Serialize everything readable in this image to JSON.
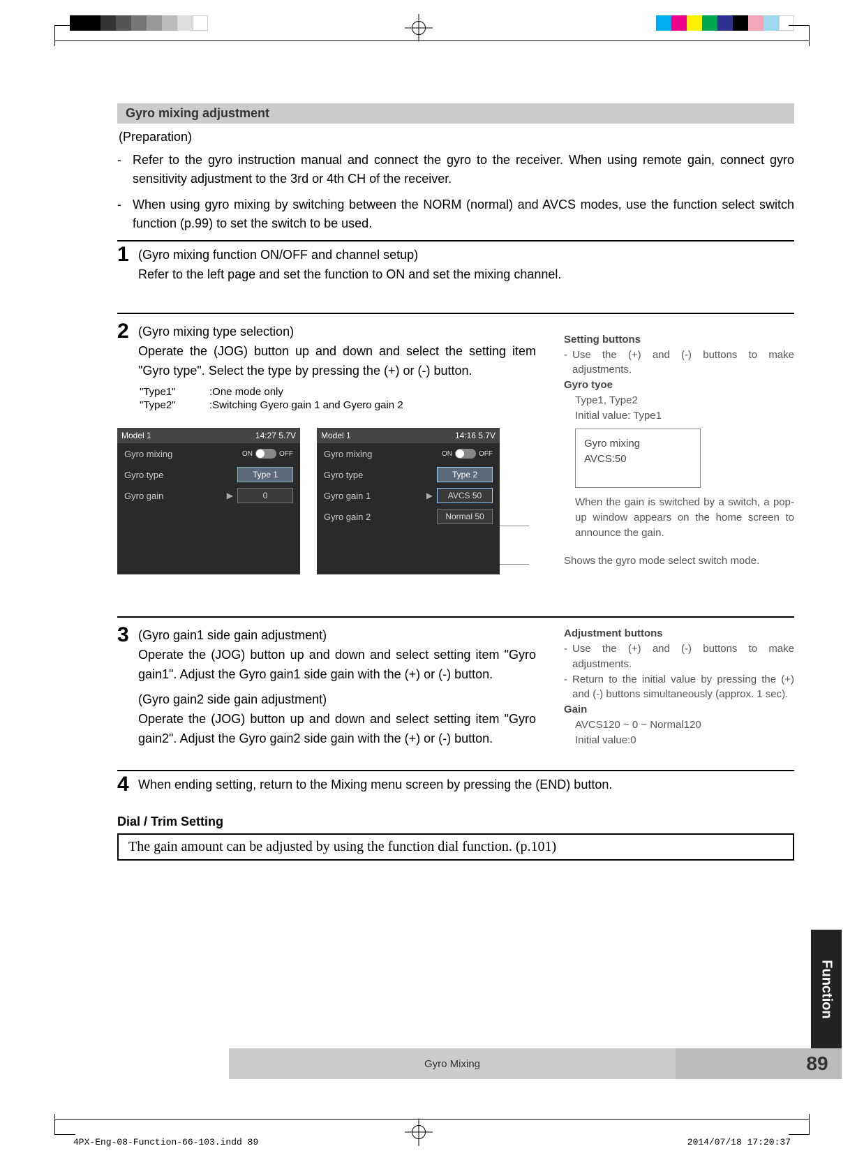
{
  "header_bar": {
    "title": "Gyro mixing adjustment"
  },
  "preparation_label": "(Preparation)",
  "bullets": [
    "Refer to the gyro instruction manual and connect the gyro to the receiver. When using remote gain, connect gyro sensitivity adjustment to the 3rd or 4th CH of the receiver.",
    "When using gyro mixing by switching between the NORM (normal) and AVCS modes, use the function select switch function (p.99) to set the switch to be used."
  ],
  "steps": {
    "s1_num": "1",
    "s1_title": "(Gyro mixing function ON/OFF and channel setup)",
    "s1_body": "Refer to the left page and set the function to ON and set the mixing channel.",
    "s2_num": "2",
    "s2_title": "(Gyro mixing type selection)",
    "s2_body": "Operate the (JOG) button up and down and select the setting item \"Gyro type\". Select the type by pressing the (+) or (-) button.",
    "s3_num": "3",
    "s3_title": "(Gyro gain1 side gain adjustment)",
    "s3_body": "Operate the (JOG) button up and down and select setting item \"Gyro gain1\". Adjust the Gyro gain1 side gain with the (+) or (-) button.",
    "s3_title2": "(Gyro gain2 side gain adjustment)",
    "s3_body2": "Operate the (JOG) button up and down and select setting item \"Gyro gain2\". Adjust the Gyro gain2 side gain with the (+) or (-) button.",
    "s4_num": "4",
    "s4_body": "When ending setting, return to the Mixing menu screen by pressing the (END) button."
  },
  "type_defs": {
    "t1_label": "\"Type1\"",
    "t1_desc": ":One mode only",
    "t2_label": "\"Type2\"",
    "t2_desc": ":Switching Gyero gain 1 and Gyero gain 2"
  },
  "side_notes": {
    "setting_buttons_title": "Setting buttons",
    "setting_buttons_text": "Use the (+) and (-) buttons to make adjustments.",
    "gyro_type_title": "Gyro tyoe",
    "gyro_type_values": "Type1, Type2",
    "gyro_type_initial": "Initial value: Type1",
    "popup_l1": "Gyro mixing",
    "popup_l2": "AVCS:50",
    "popup_note": "When the gain is switched by a switch, a pop-up window appears on the home screen to announce the gain.",
    "callout_text": "Shows the gyro mode select switch mode.",
    "adj_title": "Adjustment buttons",
    "adj_text1": "Use the (+) and (-) buttons to make adjustments.",
    "adj_text2": "Return to the initial value by pressing the (+) and (-) buttons simultaneously (approx. 1 sec).",
    "gain_title": "Gain",
    "gain_range": "AVCS120 ~ 0 ~ Normal120",
    "gain_initial": "Initial value:0"
  },
  "screens": {
    "s1": {
      "model": "Model 1",
      "time": "14:27 5.7V",
      "r1_label": "Gyro mixing",
      "r1_on": "ON",
      "r1_off": "OFF",
      "r2_label": "Gyro type",
      "r2_val": "Type 1",
      "r3_label": "Gyro gain",
      "r3_val": "0"
    },
    "s2": {
      "model": "Model 1",
      "time": "14:16 5.7V",
      "r1_label": "Gyro mixing",
      "r1_on": "ON",
      "r1_off": "OFF",
      "r2_label": "Gyro type",
      "r2_val": "Type 2",
      "r3_label": "Gyro gain 1",
      "r3_val": "AVCS  50",
      "r4_label": "Gyro gain 2",
      "r4_val": "Normal  50"
    }
  },
  "dial": {
    "heading": "Dial / Trim Setting",
    "text": "The gain amount can be adjusted by using the function dial function. (p.101)"
  },
  "footer": {
    "title": "Gyro Mixing",
    "page_num": "89",
    "side_tab": "Function"
  },
  "print_meta": {
    "left": "4PX-Eng-08-Function-66-103.indd   89",
    "right": "2014/07/18   17:20:37"
  },
  "reg_colors_left": [
    "#000",
    "#000",
    "#333",
    "#555",
    "#777",
    "#999",
    "#bbb",
    "#ddd",
    "#fff"
  ],
  "reg_colors_right": [
    "#00aeef",
    "#ec008c",
    "#fff200",
    "#00a651",
    "#2e3192",
    "#000",
    "#f4a6b8",
    "#9ed8f0",
    "#fff"
  ]
}
